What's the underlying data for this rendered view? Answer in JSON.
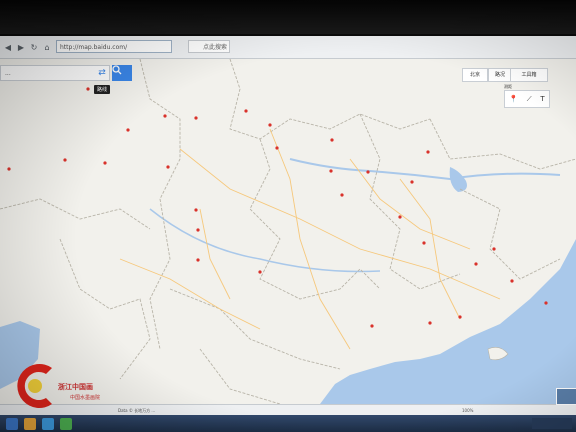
{
  "browser": {
    "address": "http://map.baidu.com/",
    "search_placeholder": "点此搜索",
    "bookmarks": []
  },
  "map_ui": {
    "search_value": "...",
    "search_icon": "magnifier-icon",
    "route_tooltip": "路线",
    "city_button": "北京",
    "traffic_button": "路况",
    "tools_button": "工具箱",
    "draw_label": "测距",
    "draw_tools": [
      "pin",
      "line",
      "text"
    ]
  },
  "map_labels": {
    "cities": [],
    "provinces": [],
    "seas": []
  },
  "status": {
    "copyright": "Data © 长地万方 ...",
    "zoom_text": "100%"
  },
  "logo": {
    "title": "浙江中国画",
    "subtitle": "中国水墨画院"
  },
  "colors": {
    "accent": "#3a86e8",
    "pin": "#d9322b",
    "water": "#a9c8ea",
    "land": "#f2f1ec",
    "border": "#b8b4a8",
    "road": "#f6c87c"
  }
}
